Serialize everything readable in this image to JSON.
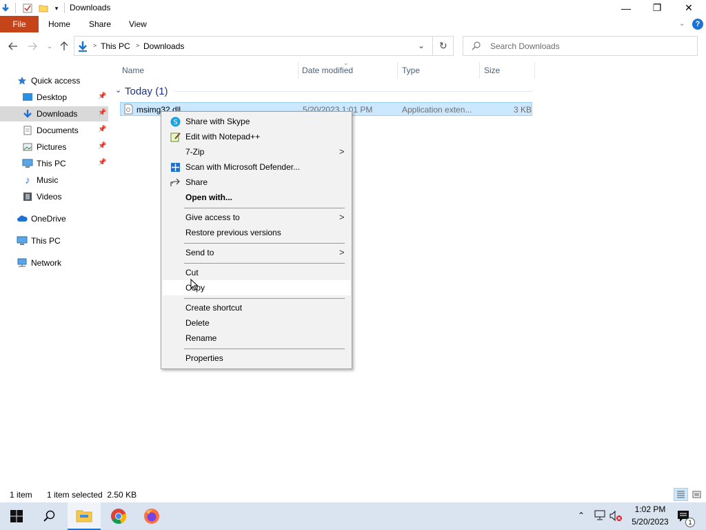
{
  "window": {
    "title": "Downloads",
    "minimize_glyph": "—",
    "restore_glyph": "❐",
    "close_glyph": "✕"
  },
  "ribbon": {
    "tabs": [
      "File",
      "Home",
      "Share",
      "View"
    ],
    "help_glyph": "?"
  },
  "address": {
    "crumbs": [
      "This PC",
      "Downloads"
    ],
    "search_placeholder": "Search Downloads"
  },
  "sidebar": {
    "items": [
      {
        "label": "Quick access",
        "icon": "star-icon"
      },
      {
        "label": "Desktop",
        "icon": "desktop-icon"
      },
      {
        "label": "Downloads",
        "icon": "download-icon"
      },
      {
        "label": "Documents",
        "icon": "document-icon"
      },
      {
        "label": "Pictures",
        "icon": "picture-icon"
      },
      {
        "label": "This PC",
        "icon": "pc-icon"
      },
      {
        "label": "Music",
        "icon": "music-icon"
      },
      {
        "label": "Videos",
        "icon": "video-icon"
      },
      {
        "label": "OneDrive",
        "icon": "cloud-icon"
      },
      {
        "label": "This PC",
        "icon": "pc-icon"
      },
      {
        "label": "Network",
        "icon": "network-icon"
      }
    ]
  },
  "columns": {
    "name": "Name",
    "date": "Date modified",
    "type": "Type",
    "size": "Size"
  },
  "group": {
    "label": "Today (1)"
  },
  "file": {
    "name": "msimg32.dll",
    "date": "5/20/2023 1:01 PM",
    "type": "Application exten...",
    "size": "3 KB"
  },
  "context_menu": {
    "items": [
      {
        "label": "Share with Skype",
        "icon": "skype-icon"
      },
      {
        "label": "Edit with Notepad++",
        "icon": "notepad-icon"
      },
      {
        "label": "7-Zip",
        "submenu": true
      },
      {
        "label": "Scan with Microsoft Defender...",
        "icon": "defender-icon"
      },
      {
        "label": "Share",
        "icon": "share-icon"
      },
      {
        "label": "Open with...",
        "bold": true
      },
      {
        "label": "Give access to",
        "submenu": true
      },
      {
        "label": "Restore previous versions"
      },
      {
        "label": "Send to",
        "submenu": true
      },
      {
        "label": "Cut"
      },
      {
        "label": "Copy"
      },
      {
        "label": "Create shortcut"
      },
      {
        "label": "Delete"
      },
      {
        "label": "Rename"
      },
      {
        "label": "Properties"
      }
    ]
  },
  "status": {
    "count": "1 item",
    "selection": "1 item selected  2.50 KB"
  },
  "taskbar": {
    "time": "1:02 PM",
    "date": "5/20/2023",
    "notification_count": "1"
  },
  "colors": {
    "file_tab": "#c5441a",
    "selection": "#cce8ff",
    "taskbar": "#dae4f0",
    "accent_blue": "#1e73d2"
  }
}
